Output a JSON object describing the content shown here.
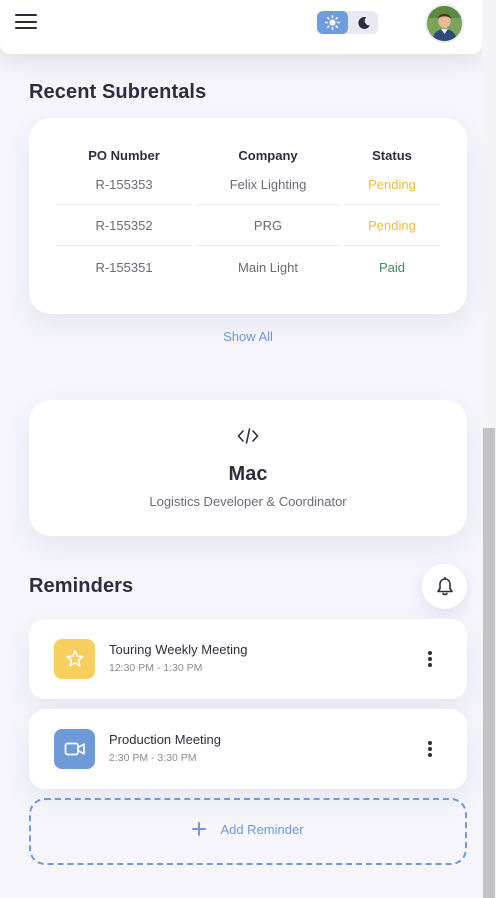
{
  "header": {
    "menu_icon": "hamburger-menu-icon",
    "theme_light_icon": "sun-icon",
    "theme_dark_icon": "moon-icon",
    "accent_color": "#6e9ce0"
  },
  "subrentals": {
    "title": "Recent Subrentals",
    "columns": [
      "PO Number",
      "Company",
      "Status"
    ],
    "rows": [
      {
        "po": "R-155353",
        "company": "Felix Lighting",
        "status": "Pending",
        "status_color": "#f0b941"
      },
      {
        "po": "R-155352",
        "company": "PRG",
        "status": "Pending",
        "status_color": "#f0b941"
      },
      {
        "po": "R-155351",
        "company": "Main Light",
        "status": "Paid",
        "status_color": "#3f8a5f"
      }
    ],
    "show_all_label": "Show All"
  },
  "profile": {
    "icon": "code-icon",
    "name": "Mac",
    "role": "Logistics Developer & Coordinator"
  },
  "reminders": {
    "title": "Reminders",
    "bell_icon": "bell-icon",
    "items": [
      {
        "title": "Touring Weekly Meeting",
        "time": "12:30 PM - 1:30 PM",
        "icon": "star-icon",
        "color": "#f8cf5c"
      },
      {
        "title": "Production Meeting",
        "time": "2:30 PM - 3:30 PM",
        "icon": "video-camera-icon",
        "color": "#6e9ad8"
      }
    ],
    "add_label": "Add Reminder"
  }
}
